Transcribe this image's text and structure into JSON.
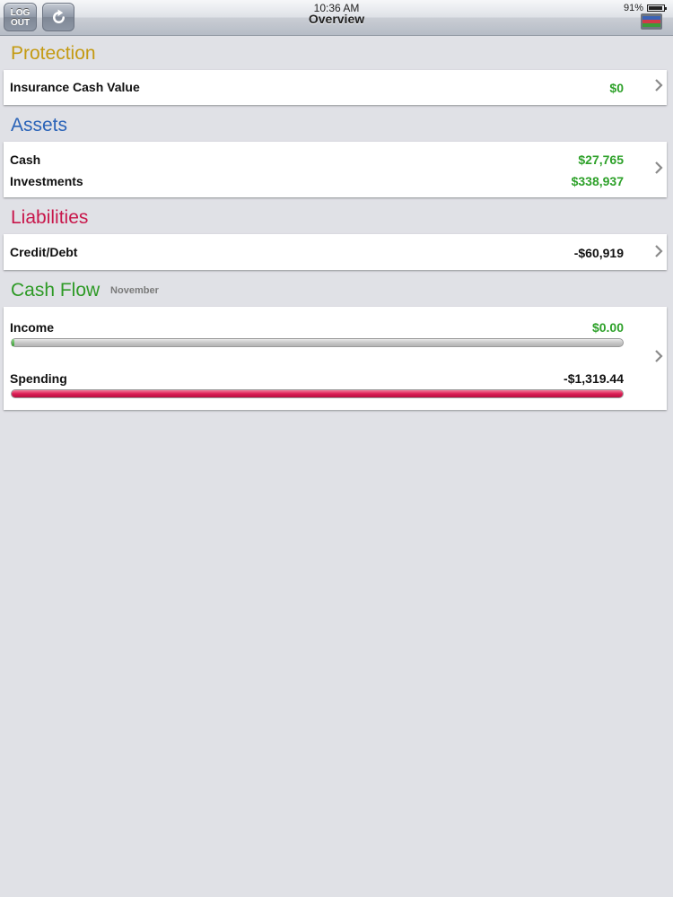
{
  "status": {
    "time": "10:36 AM",
    "battery_text": "91%",
    "battery_level": 0.91
  },
  "toolbar": {
    "logout_line1": "LOG",
    "logout_line2": "OUT",
    "title": "Overview"
  },
  "protection": {
    "title": "Protection",
    "title_color": "#c49a12",
    "rows": [
      {
        "label": "Insurance Cash Value",
        "value": "$0"
      }
    ]
  },
  "assets": {
    "title": "Assets",
    "title_color": "#2a63b8",
    "rows": [
      {
        "label": "Cash",
        "value": "$27,765"
      },
      {
        "label": "Investments",
        "value": "$338,937"
      }
    ]
  },
  "liabilities": {
    "title": "Liabilities",
    "title_color": "#c8174b",
    "rows": [
      {
        "label": "Credit/Debt",
        "value": "-$60,919"
      }
    ]
  },
  "cashflow": {
    "title": "Cash Flow",
    "title_color": "#2e9a26",
    "period": "November",
    "income": {
      "label": "Income",
      "value": "$0.00",
      "fraction": 0.004
    },
    "spending": {
      "label": "Spending",
      "value": "-$1,319.44",
      "fraction": 1.0
    }
  },
  "colors": {
    "positive": "#2ea12a",
    "negative": "#111111",
    "background": "#e0e1e6"
  }
}
